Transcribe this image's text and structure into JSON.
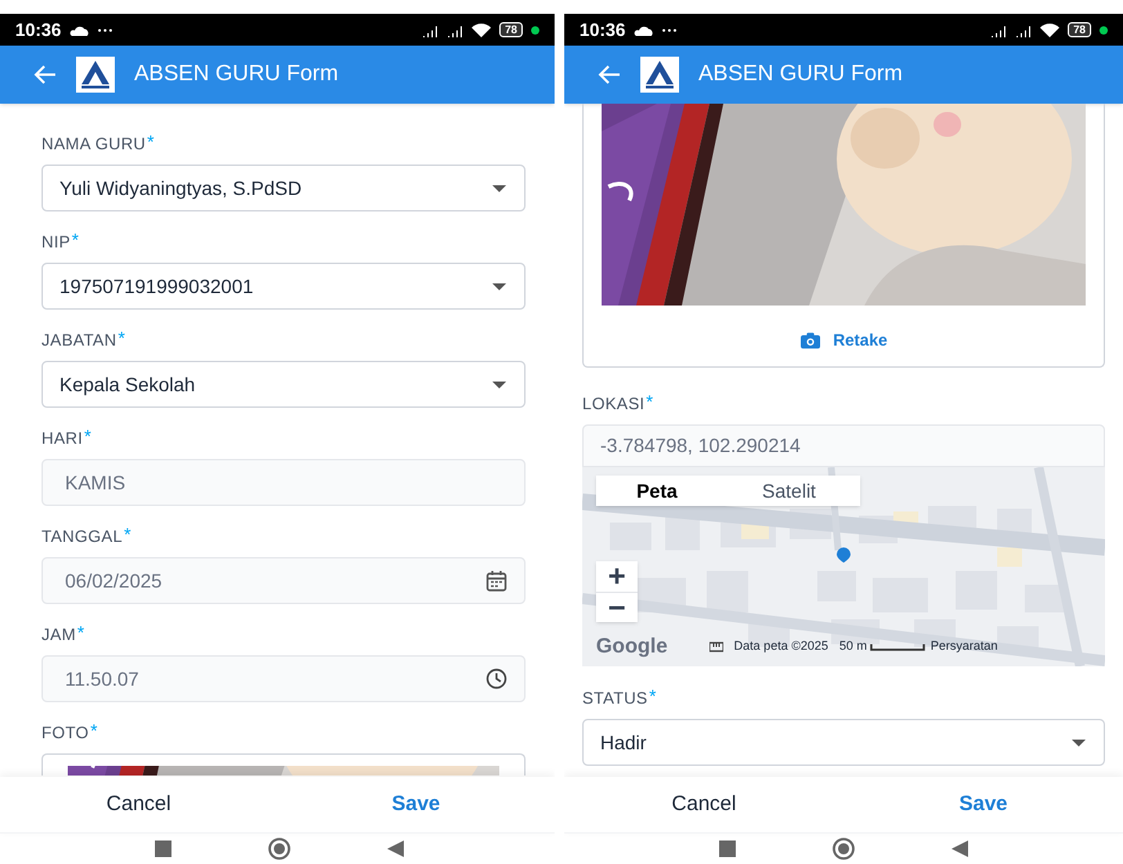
{
  "phones": [
    {
      "status_bar": {
        "time": "10:36",
        "battery": "78"
      },
      "app_bar": {
        "title": "ABSEN GURU Form"
      },
      "fields": [
        {
          "kind": "select",
          "label": "NAMA GURU",
          "mark": "*",
          "value": "Yuli Widyaningtyas, S.PdSD"
        },
        {
          "kind": "select",
          "label": "NIP",
          "mark": "*",
          "value": "197507191999032001"
        },
        {
          "kind": "select",
          "label": "JABATAN",
          "mark": "*",
          "value": "Kepala Sekolah"
        },
        {
          "kind": "text",
          "label": "HARI",
          "mark": "*",
          "value": "KAMIS",
          "disabled": true
        },
        {
          "kind": "date",
          "label": "TANGGAL",
          "mark": "*",
          "value": "06/02/2025",
          "disabled": true
        },
        {
          "kind": "time",
          "label": "JAM",
          "mark": "*",
          "value": "11.50.07",
          "disabled": true
        },
        {
          "label": "FOTO",
          "mark": "*"
        }
      ],
      "footer": {
        "cancel": "Cancel",
        "save": "Save"
      }
    },
    {
      "status_bar": {
        "time": "10:36",
        "battery": "78"
      },
      "app_bar": {
        "title": "ABSEN GURU Form"
      },
      "fields": [
        {
          "kind": "photo_card",
          "retake": "Retake"
        },
        {
          "kind": "location",
          "label": "LOKASI",
          "mark": "*",
          "value": "-3.784798, 102.290214",
          "disabled": true,
          "map": {
            "tabs": [
              {
                "label": "Peta",
                "selected": true
              },
              {
                "label": "Satelit",
                "selected": false
              }
            ],
            "zoom_in": "+",
            "zoom_out": "−",
            "logo": "Google",
            "attribution": "Data peta ©2025",
            "scale": "50 m",
            "terms": "Persyaratan"
          }
        },
        {
          "kind": "select",
          "label": "STATUS",
          "mark": "*",
          "value": "Hadir"
        }
      ],
      "footer": {
        "cancel": "Cancel",
        "save": "Save"
      }
    }
  ]
}
